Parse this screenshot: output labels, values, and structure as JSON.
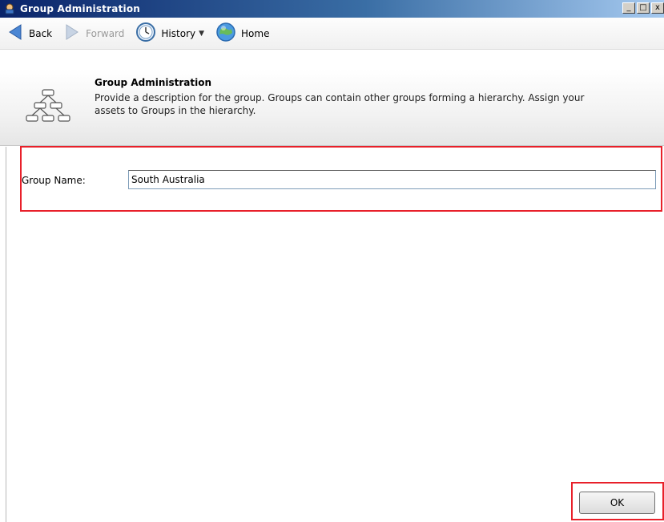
{
  "window": {
    "title": "Group Administration",
    "buttons": {
      "minimize": "_",
      "maximize": "□",
      "close": "x"
    }
  },
  "navigation": {
    "back": "Back",
    "forward": "Forward",
    "history": "History",
    "home": "Home"
  },
  "header": {
    "title": "Group Administration",
    "description": "Provide a description for the group. Groups can contain other groups forming a hierarchy. Assign your assets to Groups in the hierarchy."
  },
  "form": {
    "group_name_label": "Group Name:",
    "group_name_value": "South Australia"
  },
  "actions": {
    "ok": "OK"
  },
  "colors": {
    "highlight": "#e8202a",
    "title_bar": "#0a246a"
  }
}
